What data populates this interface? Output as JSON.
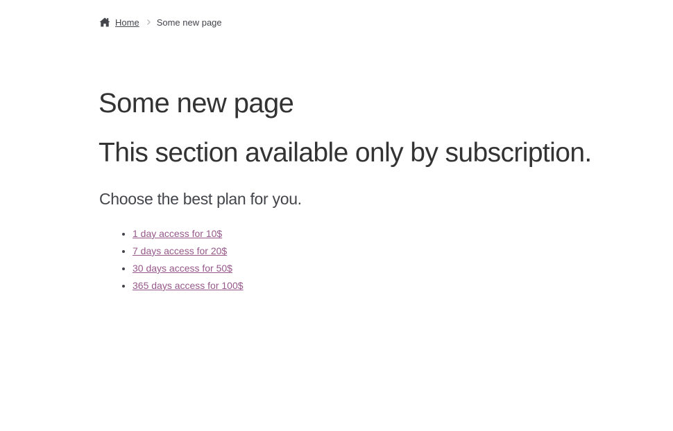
{
  "breadcrumb": {
    "home_icon": "home-icon",
    "home_label": "Home",
    "separator_icon": "chevron-right-icon",
    "current": "Some new page"
  },
  "page": {
    "title": "Some new page",
    "heading": "This section available only by subscription.",
    "subheading": "Choose the best plan for you."
  },
  "plans": [
    {
      "label": "1 day access for 10$"
    },
    {
      "label": "7 days access for 20$"
    },
    {
      "label": "30 days access for 50$"
    },
    {
      "label": "365 days access for 100$"
    }
  ],
  "colors": {
    "text": "#43454b",
    "heading": "#333333",
    "link": "#96588a",
    "separator": "#bbbbbb"
  }
}
